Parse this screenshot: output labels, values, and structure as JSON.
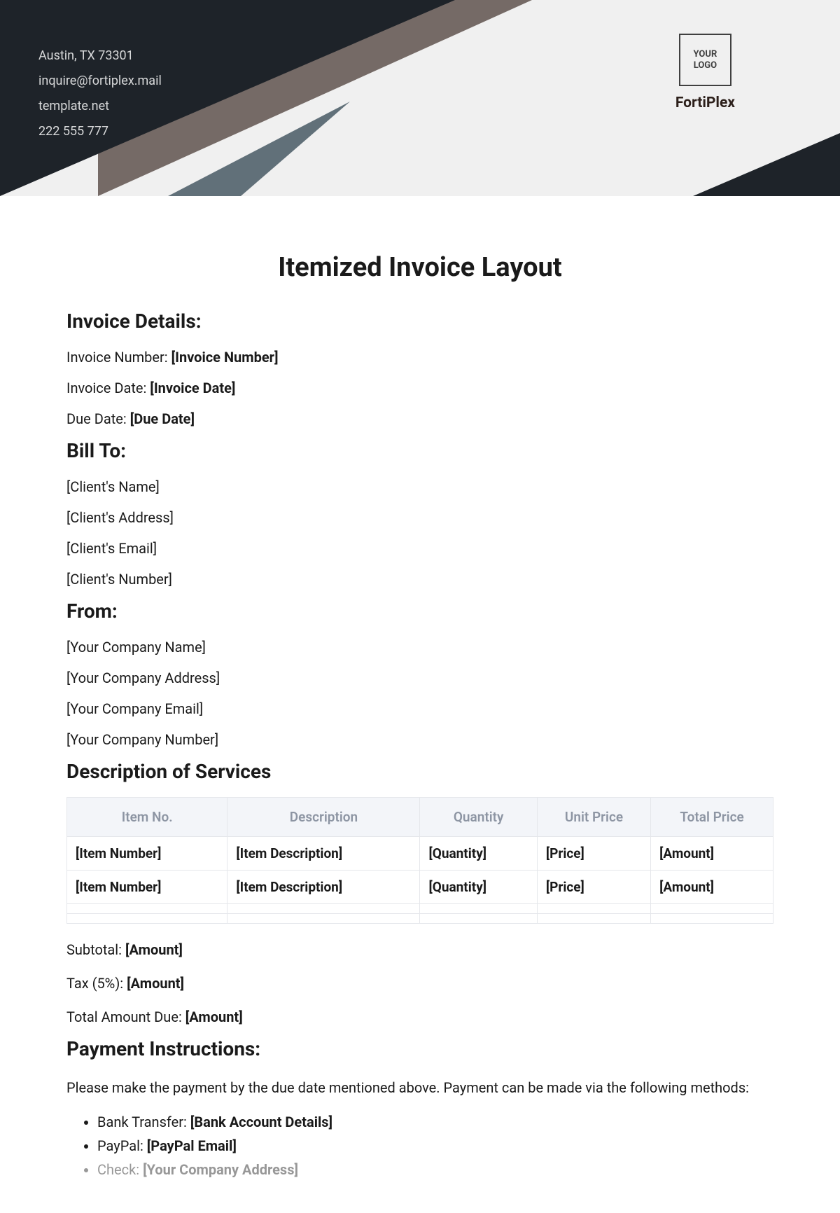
{
  "header": {
    "address": "Austin, TX 73301",
    "email": "inquire@fortiplex.mail",
    "website": "template.net",
    "phone": "222 555 777",
    "logoText": "YOUR\nLOGO",
    "companyName": "FortiPlex"
  },
  "title": "Itemized Invoice Layout",
  "sections": {
    "invoiceDetails": "Invoice Details:",
    "billTo": "Bill To:",
    "from": "From:",
    "description": "Description of Services",
    "payment": "Payment Instructions:"
  },
  "invoiceDetails": {
    "numberLabel": "Invoice Number: ",
    "numberValue": "[Invoice Number]",
    "dateLabel": "Invoice Date: ",
    "dateValue": "[Invoice Date]",
    "dueLabel": "Due Date: ",
    "dueValue": "[Due Date]"
  },
  "billTo": {
    "name": "[Client's Name]",
    "address": "[Client's Address]",
    "email": "[Client's Email]",
    "number": "[Client's Number]"
  },
  "from": {
    "name": "[Your Company Name]",
    "address": "[Your Company Address]",
    "email": "[Your Company Email]",
    "number": "[Your Company Number]"
  },
  "table": {
    "headers": {
      "itemNo": "Item No.",
      "description": "Description",
      "quantity": "Quantity",
      "unitPrice": "Unit Price",
      "totalPrice": "Total Price"
    },
    "rows": [
      {
        "itemNo": "[Item Number]",
        "description": "[Item Description]",
        "quantity": "[Quantity]",
        "unitPrice": "[Price]",
        "totalPrice": "[Amount]"
      },
      {
        "itemNo": "[Item Number]",
        "description": "[Item Description]",
        "quantity": "[Quantity]",
        "unitPrice": "[Price]",
        "totalPrice": "[Amount]"
      }
    ]
  },
  "totals": {
    "subtotalLabel": "Subtotal: ",
    "subtotalValue": "[Amount]",
    "taxLabel": "Tax (5%): ",
    "taxValue": "[Amount]",
    "totalLabel": "Total Amount Due: ",
    "totalValue": "[Amount]"
  },
  "payment": {
    "intro": "Please make the payment by the due date mentioned above. Payment can be made via the following methods:",
    "bankLabel": "Bank Transfer: ",
    "bankValue": "[Bank Account Details]",
    "paypalLabel": "PayPal: ",
    "paypalValue": "[PayPal Email]",
    "checkLabel": "Check: ",
    "checkValue": "[Your Company Address]"
  }
}
